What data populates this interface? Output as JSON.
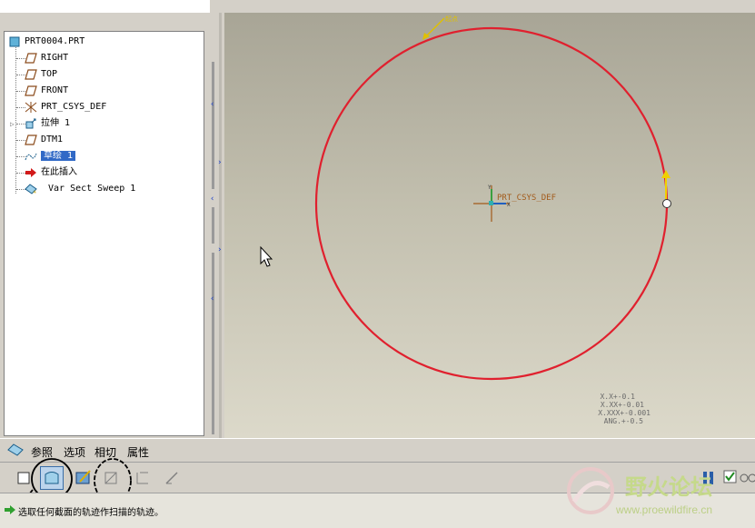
{
  "model_tree": {
    "root": "PRT0004.PRT",
    "items": [
      {
        "label": "RIGHT",
        "icon": "datum-plane-icon"
      },
      {
        "label": "TOP",
        "icon": "datum-plane-icon"
      },
      {
        "label": "FRONT",
        "icon": "datum-plane-icon"
      },
      {
        "label": "PRT_CSYS_DEF",
        "icon": "csys-icon"
      },
      {
        "label": "拉伸 1",
        "icon": "extrude-icon"
      },
      {
        "label": "DTM1",
        "icon": "datum-plane-icon"
      },
      {
        "label": "草绘 1",
        "icon": "sketch-icon"
      },
      {
        "label": "在此插入",
        "icon": "insert-arrow-icon"
      },
      {
        "label": "Var Sect Sweep 1",
        "icon": "sweep-icon"
      }
    ]
  },
  "viewport": {
    "csys_label": "PRT_CSYS_DEF",
    "axis_x": "X",
    "axis_y": "Y",
    "start_marker": "起点",
    "tolerances": [
      "X.X+-0.1",
      "X.XX+-0.01",
      "X.XXX+-0.001",
      "ANG.+-0.5"
    ],
    "curve_color": "#e0202e"
  },
  "dashboard": {
    "tabs": [
      "参照",
      "选项",
      "相切",
      "属性"
    ]
  },
  "status": {
    "message": "选取任何截面的轨迹作扫描的轨迹。"
  },
  "watermark": {
    "name": "野火论坛",
    "url": "www.proewildfire.cn"
  }
}
